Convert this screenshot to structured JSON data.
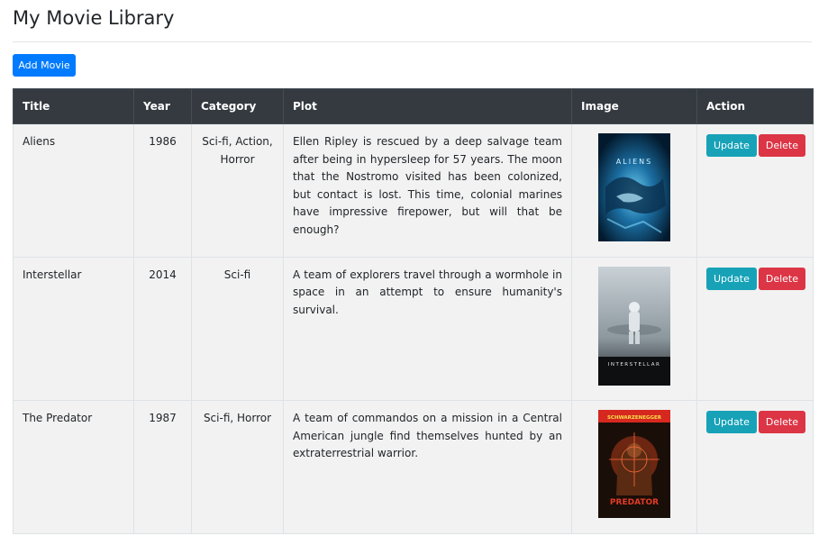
{
  "page": {
    "title": "My Movie Library",
    "add_button_label": "Add Movie"
  },
  "table": {
    "headers": [
      "Title",
      "Year",
      "Category",
      "Plot",
      "Image",
      "Action"
    ],
    "rows": [
      {
        "title": "Aliens",
        "year": "1986",
        "category": "Sci-fi, Action, Horror",
        "plot": "Ellen Ripley is rescued by a deep salvage team after being in hypersleep for 57 years. The moon that the Nostromo visited has been colonized, but contact is lost. This time, colonial marines have impressive firepower, but will that be enough?",
        "poster_text": "ALIENS",
        "update_label": "Update",
        "delete_label": "Delete"
      },
      {
        "title": "Interstellar",
        "year": "2014",
        "category": "Sci-fi",
        "plot": "A team of explorers travel through a wormhole in space in an attempt to ensure humanity's survival.",
        "poster_text": "INTERSTELLAR",
        "update_label": "Update",
        "delete_label": "Delete"
      },
      {
        "title": "The Predator",
        "year": "1987",
        "category": "Sci-fi, Horror",
        "plot": "A team of commandos on a mission in a Central American jungle find themselves hunted by an extraterrestrial warrior.",
        "poster_text_top": "SCHWARZENEGGER",
        "poster_text_bottom": "PREDATOR",
        "update_label": "Update",
        "delete_label": "Delete"
      }
    ]
  },
  "colors": {
    "header_bg": "#343a40",
    "row_bg": "#f2f2f2",
    "primary": "#007bff",
    "info": "#17a2b8",
    "danger": "#dc3545"
  }
}
